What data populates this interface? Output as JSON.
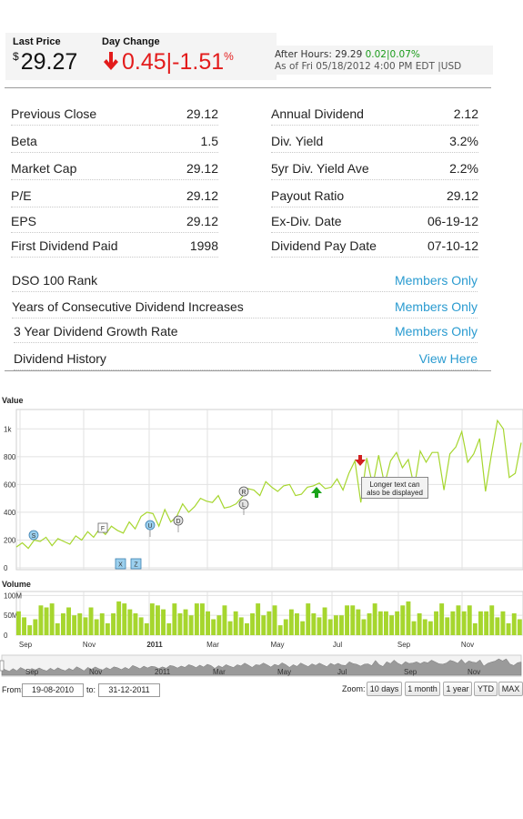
{
  "quote": {
    "last_price_label": "Last Price",
    "currency_symbol": "$",
    "last_price": "29.27",
    "day_change_label": "Day Change",
    "day_change_value": "0.45",
    "day_change_sep": "|",
    "day_change_pct": "-1.51",
    "pct_symbol": "%",
    "change_color": "#e31b1b",
    "after_hours_prefix": "After Hours: 29.29 ",
    "after_hours_change": "0.02|0.07%",
    "as_of": "As of Fri 05/18/2012 4:00 PM EDT |USD"
  },
  "stats_left": [
    {
      "label": "Previous Close",
      "value": "29.12"
    },
    {
      "label": "Beta",
      "value": "1.5"
    },
    {
      "label": "Market Cap",
      "value": "29.12"
    },
    {
      "label": "P/E",
      "value": "29.12"
    },
    {
      "label": "EPS",
      "value": "29.12"
    },
    {
      "label": "First Dividend Paid",
      "value": "1998"
    }
  ],
  "stats_right": [
    {
      "label": "Annual Dividend",
      "value": "2.12"
    },
    {
      "label": "Div. Yield",
      "value": "3.2%"
    },
    {
      "label": "5yr Div. Yield Ave",
      "value": "2.2%"
    },
    {
      "label": "Payout Ratio",
      "value": "29.12"
    },
    {
      "label": "Ex-Div. Date",
      "value": "06-19-12"
    },
    {
      "label": "Dividend Pay Date",
      "value": "07-10-12"
    }
  ],
  "stats_wide": [
    {
      "label": "DSO 100 Rank",
      "value": "Members Only"
    },
    {
      "label": "Years of Consecutive Dividend Increases",
      "value": "Members Only"
    },
    {
      "label": "3 Year Dividend Growth Rate",
      "value": "Members Only"
    },
    {
      "label": "Dividend History",
      "value": "View Here"
    }
  ],
  "chart": {
    "value_label": "Value",
    "volume_label": "Volume",
    "tooltip_text": "Longer text can also be displayed",
    "from_label": "From:",
    "from_value": "19-08-2010",
    "to_label": "to:",
    "to_value": "31-12-2011",
    "zoom_label": "Zoom:",
    "zoom_buttons": [
      "10 days",
      "1 month",
      "1 year",
      "YTD",
      "MAX"
    ],
    "flags_top": [
      "S",
      "F",
      "U",
      "D",
      "R",
      "L"
    ],
    "flags_bottom": [
      "X",
      "Z"
    ],
    "line_color": "#a6d62e",
    "bar_color": "#a6d62e"
  },
  "chart_data": [
    {
      "type": "line",
      "title": "Value",
      "ylim": [
        0,
        1100
      ],
      "y_ticks": [
        "0",
        "200",
        "400",
        "600",
        "800",
        "1k"
      ],
      "x_ticks": [
        "Sep",
        "Nov",
        "2011",
        "Mar",
        "May",
        "Jul",
        "Sep",
        "Nov"
      ],
      "grid": true,
      "values": [
        150,
        180,
        140,
        200,
        190,
        220,
        160,
        210,
        190,
        170,
        230,
        200,
        260,
        220,
        280,
        240,
        300,
        270,
        250,
        330,
        280,
        370,
        400,
        390,
        300,
        420,
        330,
        370,
        460,
        400,
        440,
        500,
        480,
        470,
        520,
        430,
        440,
        460,
        510,
        570,
        560,
        520,
        620,
        580,
        550,
        590,
        600,
        520,
        530,
        580,
        590,
        610,
        570,
        580,
        640,
        560,
        680,
        770,
        470,
        790,
        590,
        810,
        600,
        770,
        830,
        720,
        780,
        580,
        840,
        760,
        830,
        830,
        560,
        820,
        870,
        980,
        760,
        820,
        930,
        550,
        820,
        1060,
        1000,
        650,
        680,
        900
      ]
    },
    {
      "type": "bar",
      "title": "Volume",
      "ylim": [
        0,
        110
      ],
      "y_ticks": [
        "0",
        "50M",
        "100M"
      ],
      "values": [
        60,
        45,
        25,
        40,
        75,
        70,
        80,
        30,
        55,
        70,
        50,
        55,
        45,
        70,
        40,
        55,
        30,
        55,
        85,
        80,
        65,
        55,
        45,
        30,
        80,
        75,
        65,
        30,
        80,
        55,
        65,
        50,
        80,
        80,
        60,
        40,
        50,
        75,
        35,
        60,
        45,
        30,
        55,
        80,
        50,
        60,
        75,
        25,
        40,
        65,
        55,
        35,
        80,
        55,
        45,
        70,
        40,
        50,
        50,
        75,
        75,
        65,
        40,
        55,
        80,
        60,
        60,
        50,
        60,
        75,
        85,
        35,
        55,
        40,
        35,
        60,
        80,
        45,
        60,
        75,
        60,
        75,
        30,
        60,
        60,
        75,
        45,
        60,
        30,
        55,
        40
      ]
    }
  ]
}
